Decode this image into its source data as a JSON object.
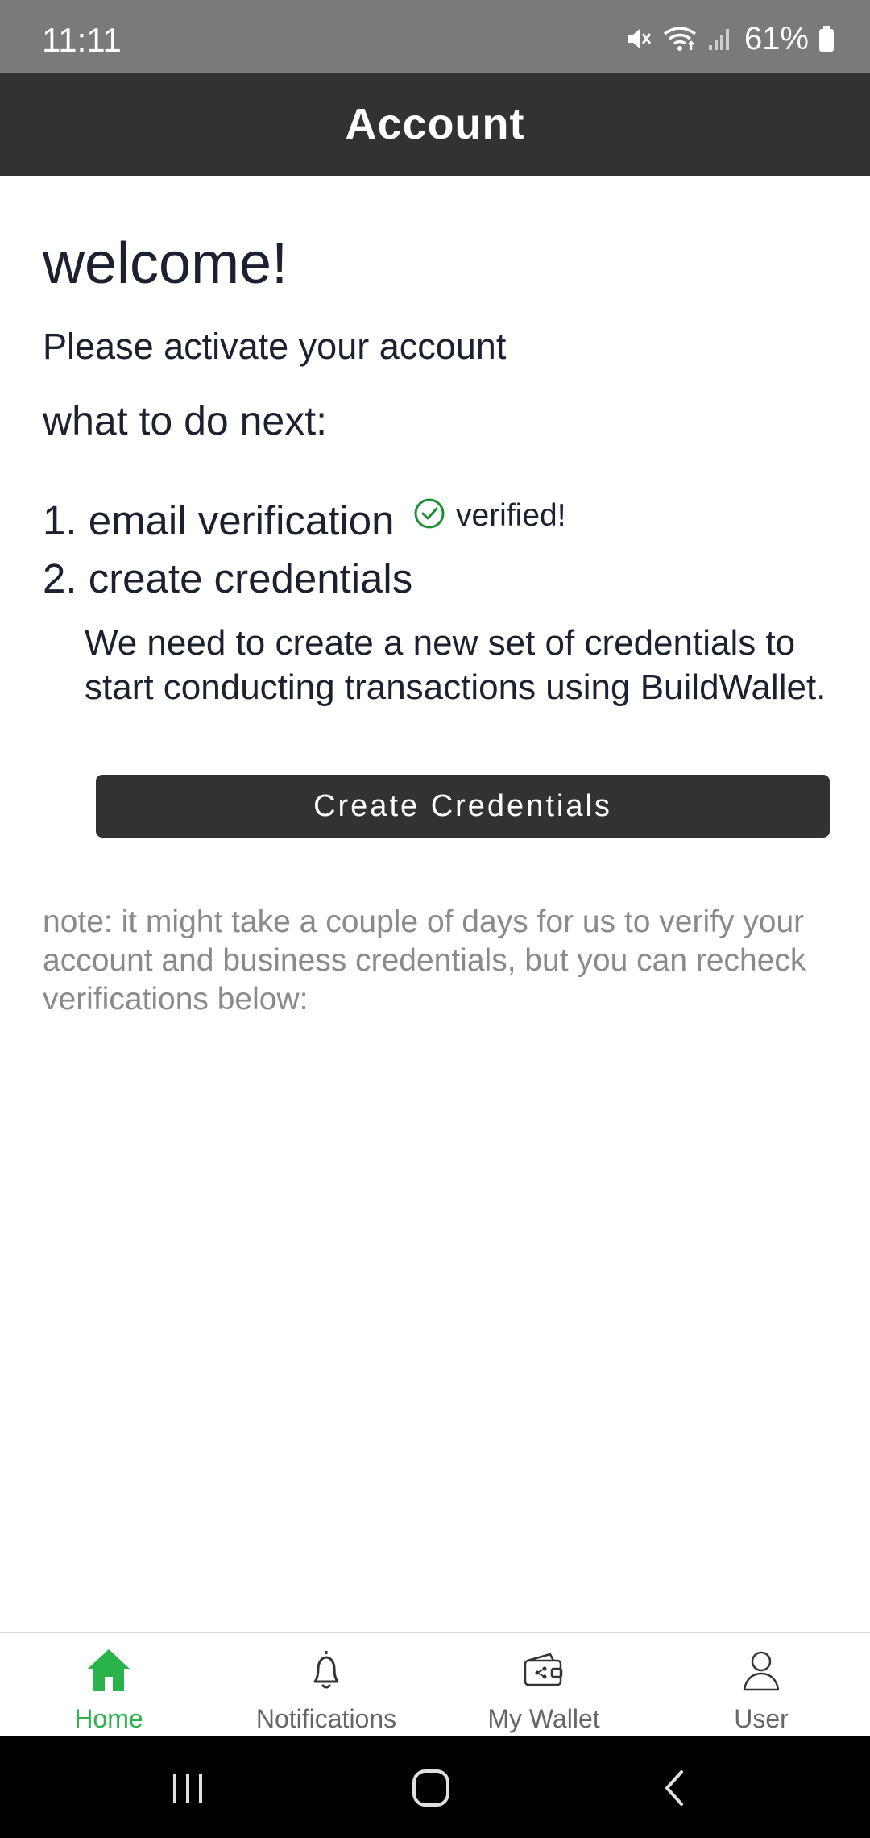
{
  "status_bar": {
    "time": "11:11",
    "battery": "61%"
  },
  "header": {
    "title": "Account"
  },
  "main": {
    "welcome": "welcome!",
    "activate_prompt": "Please activate your account",
    "next_heading": "what to do next:",
    "steps": [
      {
        "label": "1. email verification",
        "status": "verified!"
      },
      {
        "label": "2. create credentials"
      }
    ],
    "description": "We need to create a new set of credentials to start conducting transactions using BuildWallet.",
    "create_button_label": "Create Credentials",
    "note": "note: it might take a couple of days for us to verify your account and business credentials, but you can recheck verifications below:"
  },
  "tab_bar": {
    "tabs": [
      {
        "label": "Home",
        "icon": "home-icon",
        "active": true
      },
      {
        "label": "Notifications",
        "icon": "bell-icon"
      },
      {
        "label": "My Wallet",
        "icon": "wallet-icon"
      },
      {
        "label": "User",
        "icon": "user-icon"
      }
    ]
  },
  "colors": {
    "header_bg": "#323232",
    "accent_green": "#2bb34b",
    "verified_green": "#1f8f3a",
    "note_gray": "#8a8a8a"
  }
}
